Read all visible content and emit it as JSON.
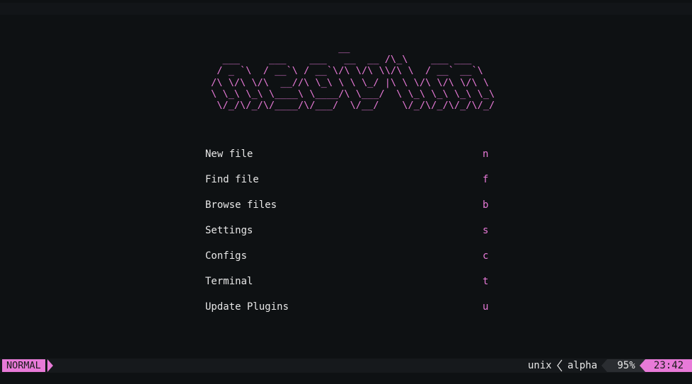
{
  "banner": "                       __\n   ___     ___    ___   __  __ /\\_\\    ___ ___\n  / _ `\\  / __`\\ / __`\\/\\ \\/\\ \\\\/\\ \\  / __` __`\\\n /\\ \\/\\ \\/\\  __//\\ \\_\\ \\ \\ \\_/ |\\ \\ \\/\\ \\/\\ \\/\\ \\\n \\ \\_\\ \\_\\ \\____\\ \\____/\\ \\___/  \\ \\_\\ \\_\\ \\_\\ \\_\\\n  \\/_/\\/_/\\/____/\\/___/  \\/__/    \\/_/\\/_/\\/_/\\/_/",
  "menu": [
    {
      "label": "New file",
      "key": "n"
    },
    {
      "label": "Find file",
      "key": "f"
    },
    {
      "label": "Browse files",
      "key": "b"
    },
    {
      "label": "Settings",
      "key": "s"
    },
    {
      "label": "Configs",
      "key": "c"
    },
    {
      "label": "Terminal",
      "key": "t"
    },
    {
      "label": "Update Plugins",
      "key": "u"
    }
  ],
  "statusline": {
    "mode": "NORMAL",
    "fileformat": "unix",
    "separator_icon": "chevron-left-icon",
    "filetype": "alpha",
    "percent": "95%",
    "clock": "23:42"
  },
  "colors": {
    "background": "#0e1113",
    "accent": "#e87ad8",
    "text": "#e8e8e8",
    "statusline_bg": "#16191c",
    "segment_bg": "#2a2d31"
  }
}
